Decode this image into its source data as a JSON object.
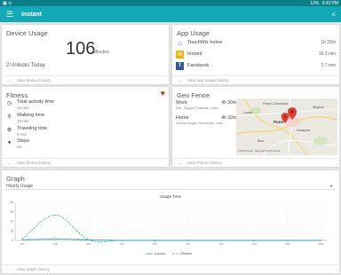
{
  "status": {
    "time": "3:43 PM",
    "battery": "13%",
    "left_icons": "▣  ⊙"
  },
  "app": {
    "title": "Instant"
  },
  "device": {
    "title": "Device Usage",
    "minutes": "106",
    "unit": "Minutes",
    "unlocks": "2 Unlocks Today",
    "footer": "View device history"
  },
  "app_usage": {
    "title": "App Usage",
    "items": [
      {
        "name": "TouchWiz home",
        "time": "1h 23m",
        "icon": "home-icon",
        "color": "#3a6db5"
      },
      {
        "name": "Instant",
        "time": "16.3 min",
        "icon": "instant-icon",
        "color": "#f2b21a"
      },
      {
        "name": "Facebook",
        "time": "3.7 min",
        "icon": "facebook-icon",
        "color": "#3b5998"
      }
    ],
    "footer": "View app usage history"
  },
  "fitness": {
    "title": "Fitness",
    "items": [
      {
        "label": "Total activity time",
        "value": "16 min",
        "icon": "clock-icon"
      },
      {
        "label": "Walking time",
        "value": "10 min",
        "icon": "walking-icon"
      },
      {
        "label": "Traveling time",
        "value": "8 min",
        "icon": "traveling-icon"
      },
      {
        "label": "Steps",
        "value": "46",
        "icon": "footprint-icon"
      }
    ],
    "footer": "View fitness history"
  },
  "geo": {
    "title": "Geo Fence",
    "places": [
      {
        "label": "Work",
        "time": "4h 30m",
        "address": "Mar, Sanjyot Software, India"
      },
      {
        "label": "Home",
        "time": "4h 32m",
        "address": "Keshav Nagar, Mundhwa, India"
      }
    ],
    "map_labels": {
      "lavale": "Lavale",
      "pune": "Pune",
      "pimpri": "Pimpri-Chinchwad",
      "wagholi": "Wagholi",
      "hadapsar": "Hadapsar",
      "bhor": "Bhor",
      "credit": "©2015 Google · Map data ©2015 Google"
    },
    "footer": "View Places history"
  },
  "graph": {
    "title": "Graph",
    "selector": "Hourly Usage",
    "footer": "View graph history"
  },
  "chart_data": {
    "type": "line",
    "title": "Usage Time",
    "ylim": [
      0,
      60
    ],
    "y_ticks": [
      "60",
      "45",
      "30",
      "15",
      "0"
    ],
    "x": [
      "1PM",
      "2PM",
      "3PM",
      "4PM",
      "5PM",
      "6PM",
      "7PM",
      "8PM",
      "9PM",
      "10PM"
    ],
    "series": [
      {
        "name": "Unlocks",
        "values": [
          1,
          2,
          1,
          0,
          0,
          0,
          0,
          0,
          0,
          0
        ],
        "color": "#26a5ad",
        "dash": false
      },
      {
        "name": "Minutes",
        "values": [
          2,
          40,
          1,
          0,
          0,
          0,
          0,
          0,
          0,
          0
        ],
        "color": "#26a5ad",
        "dash": true
      }
    ],
    "legend": "bottom-center"
  }
}
